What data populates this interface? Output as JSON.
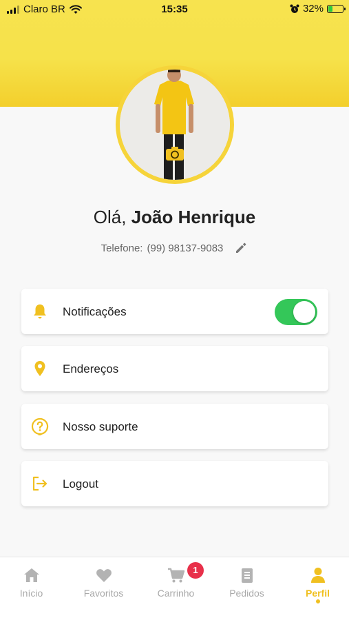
{
  "status_bar": {
    "carrier": "Claro BR",
    "time": "15:35",
    "battery_percent": "32%",
    "battery_level": 0.32
  },
  "profile": {
    "greeting_prefix": "Olá,",
    "user_name": "João Henrique",
    "phone_label": "Telefone:",
    "phone_number": "(99) 98137-9083"
  },
  "menu": [
    {
      "label": "Notificações",
      "icon": "bell-icon",
      "toggle_on": true
    },
    {
      "label": "Endereços",
      "icon": "location-pin-icon"
    },
    {
      "label": "Nosso suporte",
      "icon": "help-chat-icon"
    },
    {
      "label": "Logout",
      "icon": "logout-icon"
    }
  ],
  "tabbar": {
    "items": [
      {
        "label": "Início",
        "icon": "home-icon"
      },
      {
        "label": "Favoritos",
        "icon": "heart-icon"
      },
      {
        "label": "Carrinho",
        "icon": "cart-icon",
        "badge": "1"
      },
      {
        "label": "Pedidos",
        "icon": "orders-icon"
      },
      {
        "label": "Perfil",
        "icon": "person-icon",
        "active": true
      }
    ]
  },
  "colors": {
    "accent": "#f0c020",
    "header_yellow": "#f6e24a",
    "toggle_green": "#34c759",
    "badge_red": "#e8304a"
  }
}
